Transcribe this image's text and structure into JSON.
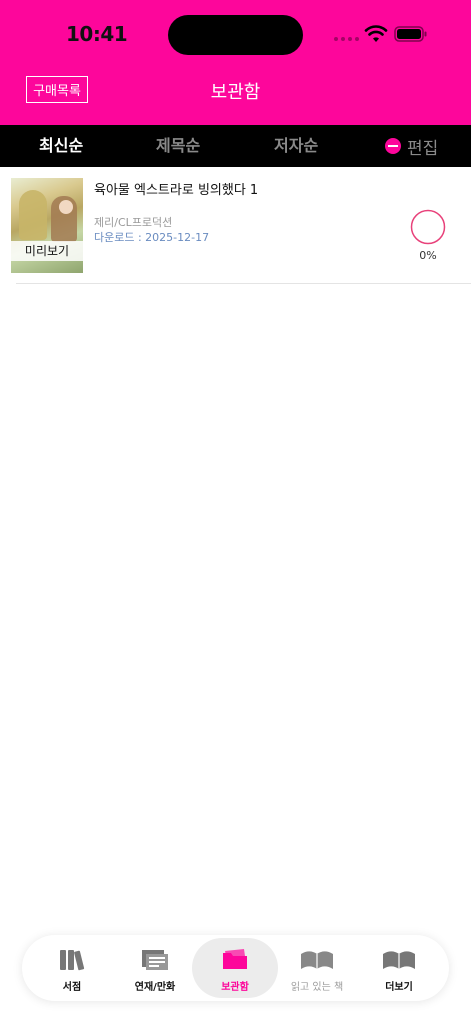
{
  "status_bar": {
    "time": "10:41"
  },
  "header": {
    "buy_list_label": "구매목록",
    "title": "보관함"
  },
  "sort_tabs": [
    {
      "label": "최신순",
      "active": true
    },
    {
      "label": "제목순",
      "active": false
    },
    {
      "label": "저자순",
      "active": false
    }
  ],
  "edit_label": "편집",
  "books": [
    {
      "title": "육아물 엑스트라로 빙의했다 1",
      "author": "제리/CL프로덕션",
      "download": "다운로드 :  2025-12-17",
      "preview_label": "미리보기",
      "progress_text": "0%",
      "progress": 0
    }
  ],
  "tab_bar": [
    {
      "label": "서점",
      "icon": "books-icon",
      "active": false
    },
    {
      "label": "연재/만화",
      "icon": "serial-icon",
      "active": false
    },
    {
      "label": "보관함",
      "icon": "storage-folder-icon",
      "active": true
    },
    {
      "label": "읽고 있는 책",
      "icon": "open-book-icon",
      "active": false
    },
    {
      "label": "더보기",
      "icon": "more-book-icon",
      "active": false
    }
  ],
  "colors": {
    "brand": "#fd069b",
    "sortbar": "#000000",
    "download": "#6a8cc0"
  }
}
